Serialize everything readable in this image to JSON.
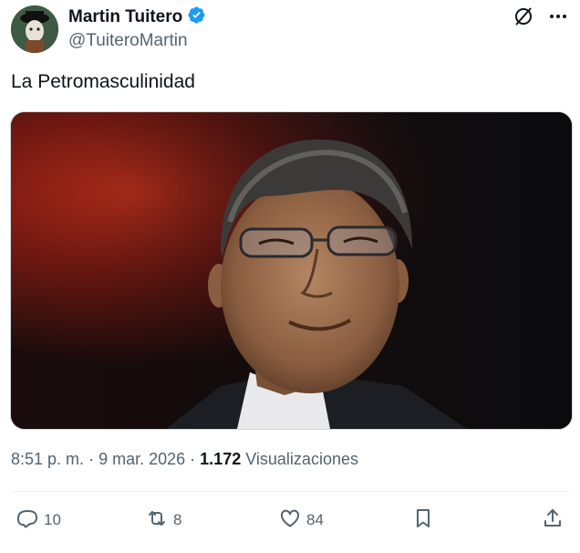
{
  "author": {
    "display_name": "Martin Tuitero",
    "handle": "@TuiteroMartin",
    "verified": true
  },
  "icons": {
    "verified": "verified-badge-icon",
    "grok": "grok-icon",
    "more": "more-options-icon",
    "reply": "reply-icon",
    "retweet": "retweet-icon",
    "like": "like-icon",
    "bookmark": "bookmark-icon",
    "share": "share-icon"
  },
  "tweet": {
    "text": "La Petromasculinidad",
    "media_alt": "Photo of a smiling man with glasses against a red and black background"
  },
  "meta": {
    "time": "8:51 p. m.",
    "separator": "·",
    "date": "9 mar. 2026",
    "views_count": "1.172",
    "views_label": "Visualizaciones"
  },
  "actions": {
    "reply_count": "10",
    "retweet_count": "8",
    "like_count": "84"
  },
  "colors": {
    "accent": "#1d9bf0",
    "muted": "#536471",
    "text": "#0f1419"
  }
}
